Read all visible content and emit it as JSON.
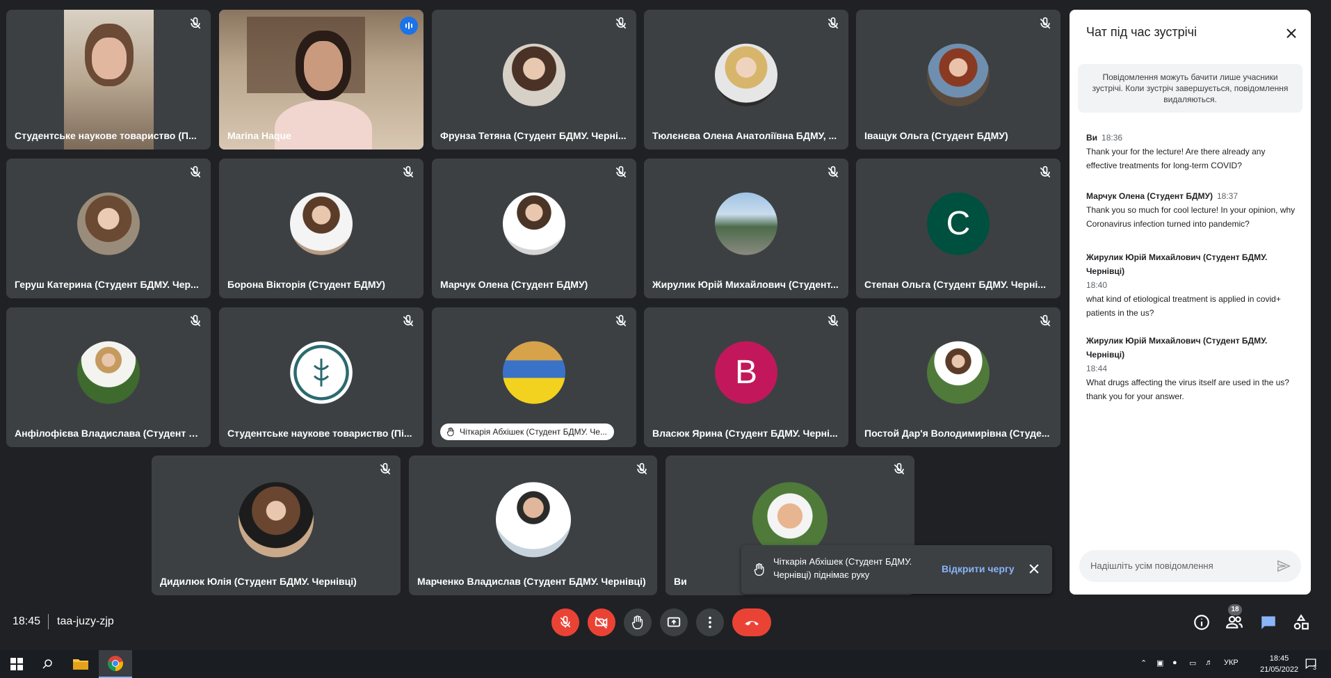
{
  "tiles": [
    {
      "name": "Студентське наукове товариство (П..."
    },
    {
      "name": "Marina Haque"
    },
    {
      "name": "Фрунза Тетяна (Студент БДМУ. Черні..."
    },
    {
      "name": "Тюлєнєва Олена Анатоліївна БДМУ, ..."
    },
    {
      "name": "Іващук Ольга (Студент БДМУ)"
    },
    {
      "name": "Геруш Катерина (Студент БДМУ. Чер..."
    },
    {
      "name": "Борона Вікторія (Студент БДМУ)"
    },
    {
      "name": "Марчук Олена (Студент БДМУ)"
    },
    {
      "name": "Жирулик Юрій Михайлович (Студент..."
    },
    {
      "name": "Степан Ольга (Студент БДМУ. Черні...",
      "initial": "C"
    },
    {
      "name": "Анфілофієва Владислава (Студент Б..."
    },
    {
      "name": "Студентське наукове товариство (Пі..."
    },
    {
      "name": "Чіткарія Абхішек (Студент БДМУ. Че..."
    },
    {
      "name": "Власюк Ярина (Студент БДМУ. Черні...",
      "initial": "B"
    },
    {
      "name": "Постой Дар'я Володимирівна (Студе..."
    },
    {
      "name": "Дидилюк Юлія (Студент БДМУ. Чернівці)"
    },
    {
      "name": "Марченко Владислав (Студент БДМУ. Чернівці)"
    },
    {
      "name": "Ви"
    }
  ],
  "chat": {
    "title": "Чат під час зустрічі",
    "notice": "Повідомлення можуть бачити лише учасники зустрічі. Коли зустріч завершується, повідомлення видаляються.",
    "messages": [
      {
        "sender": "Ви",
        "time": "18:36",
        "text": "Thank your for the lecture! Are there already any effective treatments for long-term COVID?"
      },
      {
        "sender": "Марчук Олена (Студент БДМУ)",
        "time": "18:37",
        "text": "Thank you so much for cool lecture! In your opinion, why Coronavirus infection turned into pandemic?"
      },
      {
        "sender": "Жирулик Юрій Михайлович (Студент БДМУ. Чернівці)",
        "time": "18:40",
        "text": "what kind of etiological treatment is applied in covid+ patients in the us?"
      },
      {
        "sender": "Жирулик Юрій Михайлович (Студент БДМУ. Чернівці)",
        "time": "18:44",
        "text": "What drugs affecting the virus itself are used in the us? thank you for your answer."
      }
    ],
    "input_placeholder": "Надішліть усім повідомлення"
  },
  "toast": {
    "text": "Чіткарія Абхішек (Студент БДМУ. Чернівці) піднімає руку",
    "action": "Відкрити чергу"
  },
  "meeting": {
    "time": "18:45",
    "code": "taa-juzy-zjp",
    "participants_badge": "18"
  },
  "taskbar": {
    "lang": "УКР",
    "time": "18:45",
    "date": "21/05/2022",
    "notif_count": "3"
  },
  "colors": {
    "accent": "#8ab4f8",
    "danger": "#ea4335",
    "tile": "#3c4043",
    "bg": "#202124"
  }
}
